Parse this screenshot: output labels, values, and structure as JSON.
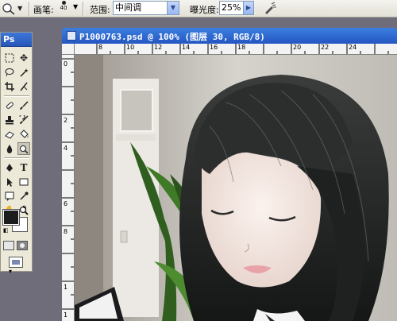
{
  "options_bar": {
    "brush_label": "画笔:",
    "brush_size": "40",
    "range_label": "范围:",
    "range_value": "中间调",
    "exposure_label": "曝光度:",
    "exposure_value": "25%"
  },
  "toolbox": {
    "header": "Ps",
    "foreground_color": "#1c1c1c",
    "background_color": "#ffffff"
  },
  "document": {
    "title": "P1000763.psd @ 100% (图层 30, RGB/8)",
    "ruler_top": [
      "8",
      "10",
      "12",
      "14",
      "16",
      "18",
      "20",
      "22",
      "24"
    ],
    "ruler_left": [
      "0",
      "2",
      "4",
      "6",
      "8",
      "1",
      "1"
    ]
  },
  "colors": {
    "workspace": "#6f6d7a",
    "title_bar": "#2456c2",
    "toolbox_header": "#3d76d8"
  }
}
